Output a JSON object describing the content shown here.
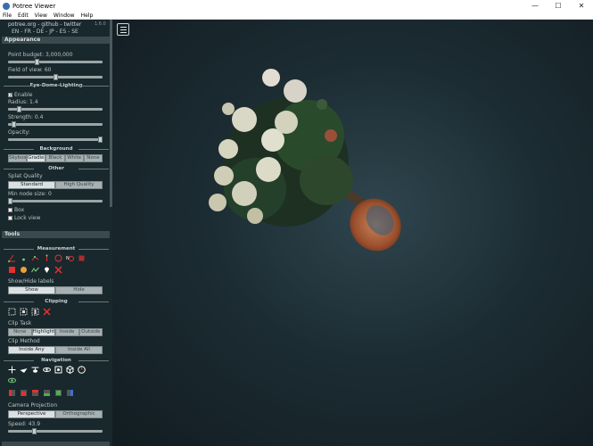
{
  "window": {
    "title": "Potree Viewer",
    "minimize": "—",
    "maximize": "☐",
    "close": "✕"
  },
  "menu": [
    "File",
    "Edit",
    "View",
    "Window",
    "Help"
  ],
  "sidebar": {
    "links": "potree.org - github - twitter",
    "version": "1.6.0",
    "languages": "EN - FR - DE - JP - ES - SE",
    "appearance": {
      "header": "Appearance",
      "point_budget": "Point budget: 3,000,000",
      "point_budget_level": 0.3,
      "fov": "Field of view: 60",
      "fov_level": 0.5,
      "edl_header": "Eye-Dome-Lighting",
      "enable": "Enable",
      "radius": "Radius: 1.4",
      "radius_level": 0.1,
      "strength": "Strength: 0.4",
      "strength_level": 0.04,
      "opacity": "Opacity:",
      "opacity_level": 1.0,
      "background_header": "Background",
      "background_options": [
        "Skybox",
        "Gradient",
        "Black",
        "White",
        "None"
      ],
      "background_selected": 1,
      "other_header": "Other",
      "splat_quality": "Splat Quality",
      "splat_options": [
        "Standard",
        "High Quality"
      ],
      "min_node": "Min node size: 0",
      "min_node_level": 0.0,
      "box": "Box",
      "lock_view": "Lock view"
    },
    "tools": {
      "header": "Tools",
      "measurement_header": "Measurement",
      "show_hide": "Show/Hide labels",
      "show": "Show",
      "hide": "Hide",
      "clipping_header": "Clipping",
      "clip_task": "Clip Task",
      "clip_task_options": [
        "None",
        "Highlight",
        "Inside",
        "Outside"
      ],
      "clip_task_selected": 1,
      "clip_method": "Clip Method",
      "clip_method_options": [
        "Inside Any",
        "Inside All"
      ],
      "navigation_header": "Navigation",
      "camera_projection": "Camera Projection",
      "projection_options": [
        "Perspective",
        "Orthographic"
      ],
      "speed": "Speed: 43.9",
      "speed_level": 0.27
    }
  },
  "colors": {
    "sidebar_bg": "#19282c",
    "viewport_center": "#2f454e",
    "accent_red": "#e53030"
  },
  "icons": {
    "measurement": [
      "angle-icon",
      "point-icon",
      "distance-icon",
      "height-icon",
      "circle-icon",
      "azimuth-icon",
      "area-icon",
      "volume-icon",
      "sphere-volume-icon",
      "profile-icon",
      "annotation-icon",
      "remove-icon"
    ],
    "clipping": [
      "clip-volume-icon",
      "clip-polygon-icon",
      "clip-profile-icon",
      "clip-remove-icon"
    ],
    "navigation": [
      "earth-controls-icon",
      "fly-controls-icon",
      "helicopter-controls-icon",
      "orbit-controls-icon",
      "full-extent-icon",
      "navigation-cube-icon",
      "compass-icon",
      "eye-icon"
    ],
    "views": [
      "left-view-icon",
      "front-view-icon",
      "top-view-icon",
      "bottom-view-icon",
      "back-view-icon",
      "right-view-icon"
    ]
  }
}
